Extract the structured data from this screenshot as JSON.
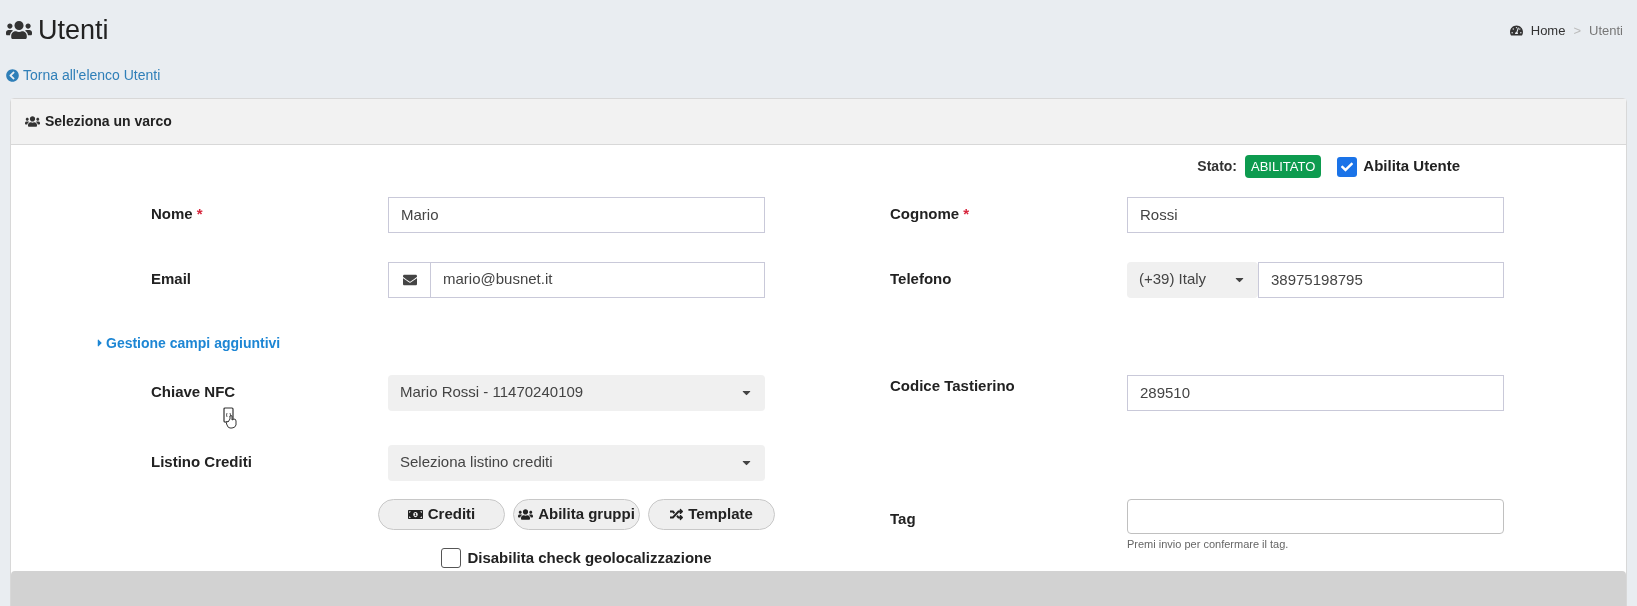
{
  "page": {
    "title": "Utenti",
    "breadcrumb": [
      {
        "label": "Home"
      },
      {
        "label": "Utenti"
      }
    ],
    "breadcrumb_separator": ">",
    "back_link": "Torna all'elenco Utenti"
  },
  "panel": {
    "title": "Seleziona un varco",
    "status_label": "Stato:",
    "status_badge": "ABILITATO",
    "enable_user": {
      "label": "Abilita Utente",
      "checked": true
    }
  },
  "nome": {
    "label": "Nome",
    "marker": "*",
    "value": "Mario"
  },
  "cognome": {
    "label": "Cognome",
    "marker": "*",
    "value": "Rossi"
  },
  "email": {
    "label": "Email",
    "value": "mario@busnet.it"
  },
  "telefono": {
    "label": "Telefono",
    "country": "(+39) Italy",
    "value": "38975198795"
  },
  "extra_fields_link": "Gestione campi aggiuntivi",
  "chiave_nfc": {
    "label": "Chiave NFC",
    "value": "Mario Rossi - 11470240109"
  },
  "codice_tastierino": {
    "label": "Codice Tastierino",
    "value": "289510"
  },
  "listino_crediti": {
    "label": "Listino Crediti",
    "value": "Seleziona listino crediti"
  },
  "buttons": [
    {
      "kind": "money",
      "label": "Crediti"
    },
    {
      "kind": "users",
      "label": "Abilita gruppi"
    },
    {
      "kind": "shuffle",
      "label": "Template"
    }
  ],
  "disable_geo": {
    "label": "Disabilita check geolocalizzazione",
    "checked": false
  },
  "tag": {
    "label": "Tag",
    "help": "Premi invio per confermare il tag."
  }
}
